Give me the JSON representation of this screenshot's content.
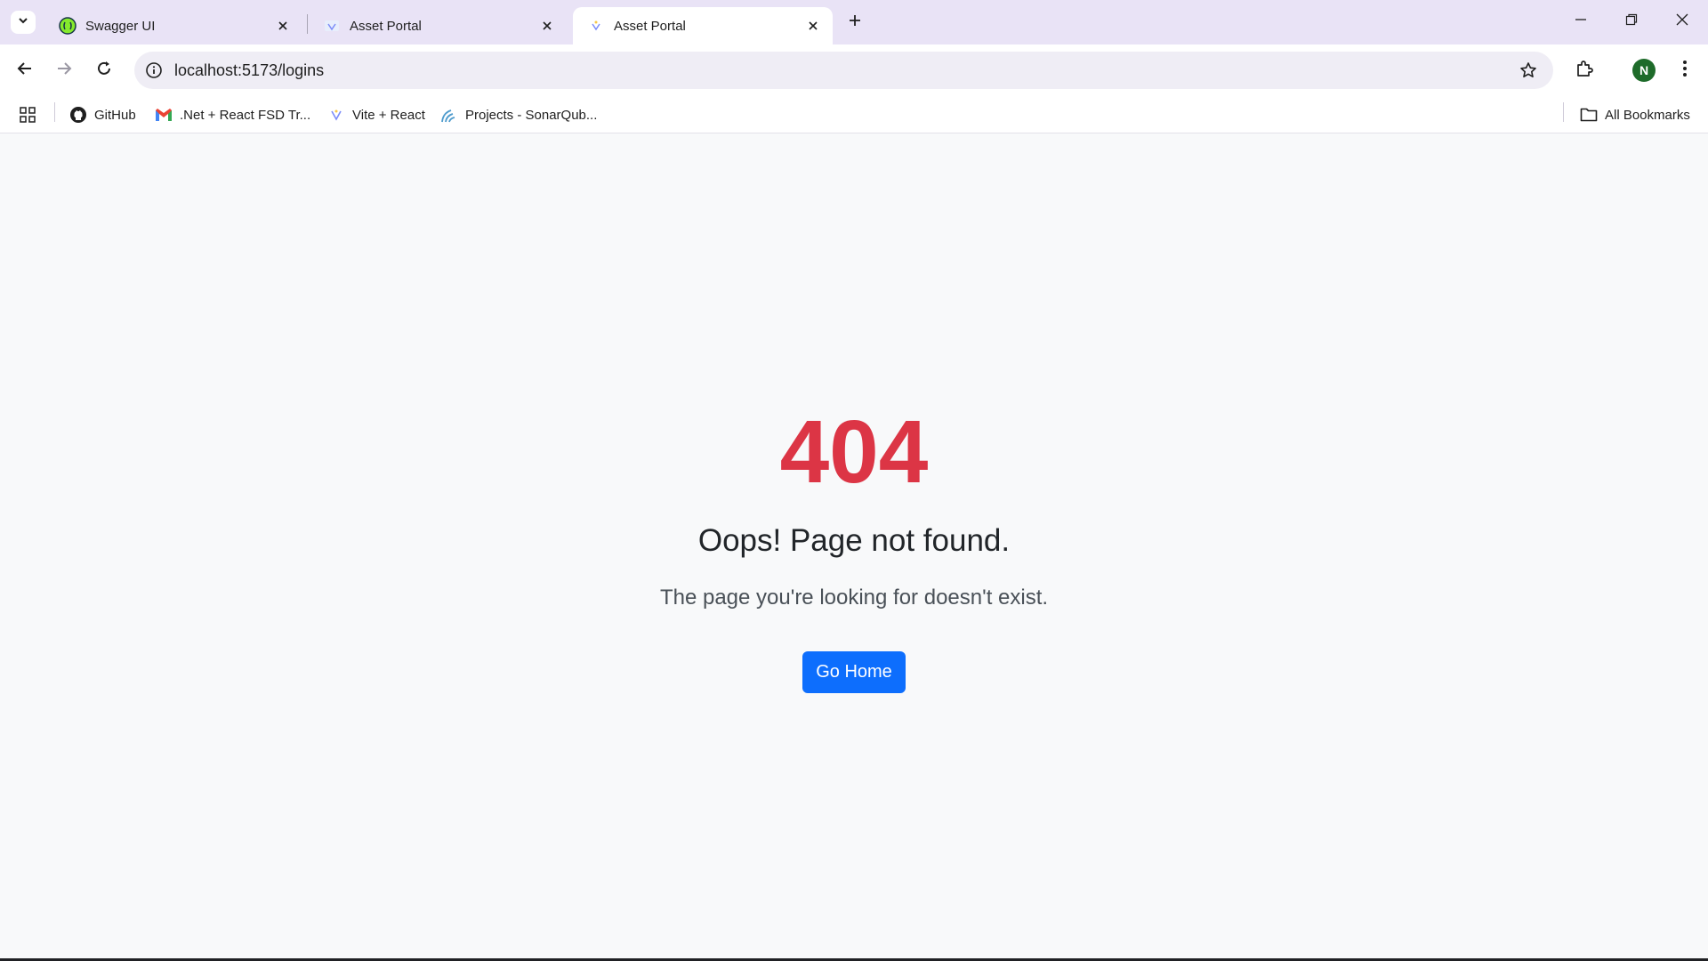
{
  "browser": {
    "tabs": [
      {
        "title": "Swagger UI",
        "favicon": "swagger-icon",
        "active": false
      },
      {
        "title": "Asset Portal",
        "favicon": "vite-icon",
        "active": false
      },
      {
        "title": "Asset Portal",
        "favicon": "vite-icon",
        "active": true
      }
    ],
    "url": "localhost:5173/logins",
    "profile_initial": "N",
    "bookmarks": [
      {
        "label": "GitHub",
        "icon": "github-icon"
      },
      {
        "label": ".Net + React FSD Tr...",
        "icon": "gmail-icon"
      },
      {
        "label": "Vite + React",
        "icon": "vite-icon"
      },
      {
        "label": "Projects - SonarQub...",
        "icon": "sonarqube-icon"
      }
    ],
    "all_bookmarks_label": "All Bookmarks"
  },
  "page": {
    "code": "404",
    "title": "Oops! Page not found.",
    "description": "The page you're looking for doesn't exist.",
    "button_label": "Go Home"
  },
  "colors": {
    "error_red": "#dc3545",
    "primary_blue": "#0d6efd",
    "tabstrip_bg": "#e9e3f6"
  }
}
